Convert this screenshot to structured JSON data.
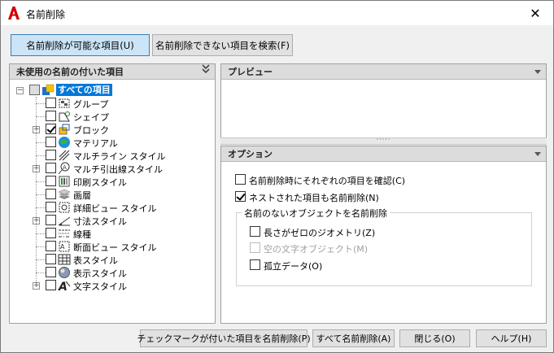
{
  "window": {
    "title": "名前削除"
  },
  "top_buttons": {
    "purgeable": "名前削除が可能な項目(U)",
    "non_purgeable": "名前削除できない項目を検索(F)"
  },
  "left_panel": {
    "header": "未使用の名前の付いた項目",
    "items": [
      {
        "label": "すべての項目",
        "checked": false,
        "expandable": false,
        "selected": true
      },
      {
        "label": "グループ",
        "checked": false,
        "expandable": false
      },
      {
        "label": "シェイプ",
        "checked": false,
        "expandable": false
      },
      {
        "label": "ブロック",
        "checked": true,
        "expandable": true
      },
      {
        "label": "マテリアル",
        "checked": false,
        "expandable": false
      },
      {
        "label": "マルチライン スタイル",
        "checked": false,
        "expandable": false
      },
      {
        "label": "マルチ引出線スタイル",
        "checked": false,
        "expandable": true
      },
      {
        "label": "印刷スタイル",
        "checked": false,
        "expandable": false
      },
      {
        "label": "画層",
        "checked": false,
        "expandable": false
      },
      {
        "label": "詳細ビュー スタイル",
        "checked": false,
        "expandable": false
      },
      {
        "label": "寸法スタイル",
        "checked": false,
        "expandable": true
      },
      {
        "label": "線種",
        "checked": false,
        "expandable": false
      },
      {
        "label": "断面ビュー スタイル",
        "checked": false,
        "expandable": false
      },
      {
        "label": "表スタイル",
        "checked": false,
        "expandable": false
      },
      {
        "label": "表示スタイル",
        "checked": false,
        "expandable": false
      },
      {
        "label": "文字スタイル",
        "checked": false,
        "expandable": true
      }
    ]
  },
  "preview": {
    "header": "プレビュー"
  },
  "options": {
    "header": "オプション",
    "confirm_each": "名前削除時にそれぞれの項目を確認(C)",
    "nested": "ネストされた項目も名前削除(N)",
    "group_title": "名前のないオブジェクトを名前削除",
    "zero_length": "長さがゼロのジオメトリ(Z)",
    "empty_text": "空の文字オブジェクト(M)",
    "orphan_data": "孤立データ(O)"
  },
  "buttons": {
    "purge_checked": "チェックマークが付いた項目を名前削除(P)",
    "purge_all": "すべて名前削除(A)",
    "close": "閉じる(O)",
    "help": "ヘルプ(H)"
  },
  "colors": {
    "accent": "#0078d7",
    "active_button": "#cce4f7",
    "app_icon": "#d00000"
  }
}
